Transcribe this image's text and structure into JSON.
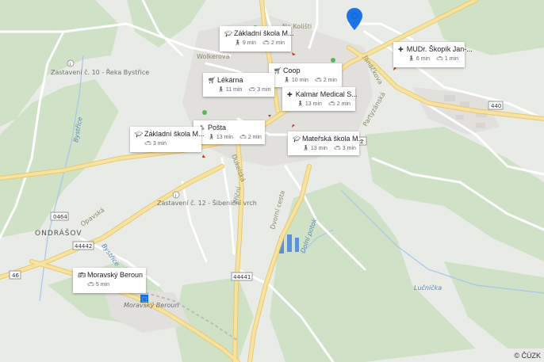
{
  "map": {
    "road_labels": [
      "Na Kolišti",
      "Wolkerova",
      "Janáčkova",
      "Partyzánská",
      "Dukelská",
      "Příční",
      "Opavská",
      "Bystřice",
      "Dvorní cesta",
      "Dolní potok",
      "Lučnička",
      "Bystřice"
    ],
    "poi_labels": [
      "Zastavení č. 10 - Řeka Bystřice",
      "Zastavení č. 12 - Šibeniční vrch",
      "Moravský Beroun"
    ],
    "town_label": "ONDRÁŠOV",
    "road_numbers": [
      "0464",
      "44442",
      "46",
      "44441",
      "440",
      "2"
    ],
    "copyright": "© ČÚZK",
    "colors": {
      "background": "#e9ece6",
      "forest": "#c9dec0",
      "road": "#f5d98a",
      "pin": "#1a73e8"
    }
  },
  "cards": [
    {
      "name": "Základní škola M...",
      "icon": "school-icon",
      "walk": "9 min",
      "car": "2 min"
    },
    {
      "name": "MUDr. Škopík Jan-...",
      "icon": "medical-icon",
      "walk": "6 min",
      "car": "1 min"
    },
    {
      "name": "Coop",
      "icon": "cart-icon",
      "walk": "10 min",
      "car": "2 min"
    },
    {
      "name": "Lékárna",
      "icon": "cart-icon",
      "walk": "11 min",
      "car": "3 min"
    },
    {
      "name": "Kalmar Medical S...",
      "icon": "medical-icon",
      "walk": "13 min",
      "car": "2 min"
    },
    {
      "name": "Pošta",
      "icon": "post-icon",
      "walk": "13 min",
      "car": "2 min"
    },
    {
      "name": "Základní škola M...",
      "icon": "school-icon",
      "walk": "",
      "car": "3 min"
    },
    {
      "name": "Mateřská škola M...",
      "icon": "school-icon",
      "walk": "13 min",
      "car": "3 min"
    },
    {
      "name": "Moravský Beroun",
      "icon": "bus-icon",
      "walk": "",
      "car": "5 min"
    }
  ]
}
